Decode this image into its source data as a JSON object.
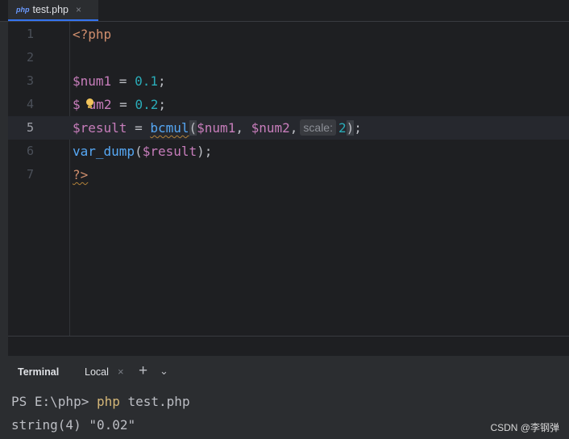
{
  "tab": {
    "icon_label": "php",
    "filename": "test.php",
    "close": "×"
  },
  "editor": {
    "line_numbers": [
      "1",
      "2",
      "3",
      "4",
      "5",
      "6",
      "7"
    ],
    "current_line": "5",
    "l1": {
      "tag": "<?php"
    },
    "l3": {
      "var": "$num1",
      "op": " = ",
      "num": "0.1",
      "end": ";"
    },
    "l4": {
      "var_a": "$",
      "var_b": "um2",
      "op": " = ",
      "num": "0.2",
      "end": ";"
    },
    "l5": {
      "var": "$result",
      "op": " = ",
      "fn": "bcmul",
      "open": "(",
      "arg1": "$num1",
      "comma1": ", ",
      "arg2": "$num2",
      "comma2": ",",
      "hint": "scale:",
      "num": "2",
      "close": ")",
      "end": ";"
    },
    "l6": {
      "fn": "var_dump",
      "open": "(",
      "var": "$result",
      "close": ")",
      "end": ";"
    },
    "l7": {
      "tag": "?>"
    }
  },
  "terminal": {
    "title": "Terminal",
    "tab": "Local",
    "close": "×",
    "add": "+",
    "more": "⌄",
    "prompt": "PS E:\\php> ",
    "cmd": "php",
    "args": " test.php",
    "output": "string(4) \"0.02\""
  },
  "watermark": "CSDN @李钢弹"
}
